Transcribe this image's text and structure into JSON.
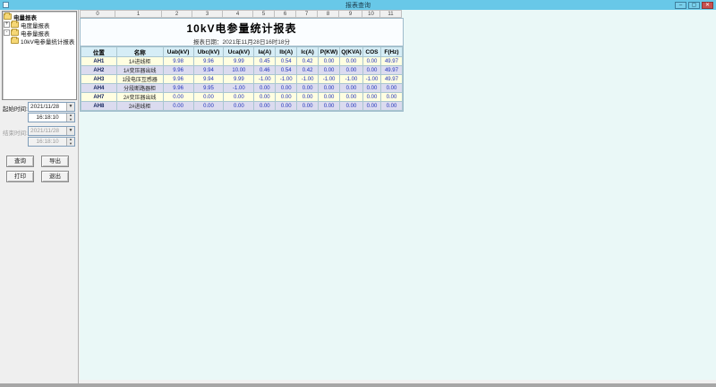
{
  "window": {
    "title": "报表查询",
    "minimize_glyph": "–",
    "maximize_glyph": "▢",
    "close_glyph": "✕"
  },
  "sidebar": {
    "tree": {
      "root_label": "电量报表",
      "items": [
        {
          "label": "电度量报表",
          "expander": "+",
          "level": 1
        },
        {
          "label": "电参量报表",
          "expander": "-",
          "level": 1
        },
        {
          "label": "10kV电参量统计报表",
          "expander": "",
          "level": 2
        }
      ]
    },
    "start_time_label": "起始时间:",
    "end_time_label": "结束时间:",
    "start_date": "2021/11/28",
    "start_time": "16:18:10",
    "end_date": "2021/11/28",
    "end_time": "16:18:10",
    "dropdown_glyph": "▼",
    "spin_up_glyph": "▲",
    "spin_down_glyph": "▼",
    "buttons": {
      "query": "查询",
      "export": "导出",
      "print": "打印",
      "exit": "退出"
    }
  },
  "report": {
    "ruler": [
      "0",
      "1",
      "2",
      "3",
      "4",
      "5",
      "6",
      "7",
      "8",
      "9",
      "10",
      "11"
    ],
    "title": "10kV电参量统计报表",
    "date_line": "报表日期：2021年11月28日16时18分",
    "columns": [
      "位置",
      "名称",
      "Uab(kV)",
      "Ubc(kV)",
      "Uca(kV)",
      "Ia(A)",
      "Ib(A)",
      "Ic(A)",
      "P(KW)",
      "Q(KVA)",
      "COS",
      "F(Hz)"
    ],
    "rows": [
      {
        "loc": "AH1",
        "name": "1#进线柜",
        "values": [
          "9.98",
          "9.96",
          "9.99",
          "0.45",
          "0.54",
          "0.42",
          "0.00",
          "0.00",
          "0.00",
          "49.97"
        ]
      },
      {
        "loc": "AH2",
        "name": "1#变压器出线",
        "values": [
          "9.96",
          "9.94",
          "10.00",
          "0.46",
          "0.54",
          "0.42",
          "0.00",
          "0.00",
          "0.00",
          "49.97"
        ]
      },
      {
        "loc": "AH3",
        "name": "1段电压互感器",
        "values": [
          "9.96",
          "9.94",
          "9.99",
          "-1.00",
          "-1.00",
          "-1.00",
          "-1.00",
          "-1.00",
          "-1.00",
          "49.97"
        ]
      },
      {
        "loc": "AH4",
        "name": "分段断路器柜",
        "values": [
          "9.96",
          "9.95",
          "-1.00",
          "0.00",
          "0.00",
          "0.00",
          "0.00",
          "0.00",
          "0.00",
          "0.00"
        ]
      },
      {
        "loc": "AH7",
        "name": "2#变压器出线",
        "values": [
          "0.00",
          "0.00",
          "0.00",
          "0.00",
          "0.00",
          "0.00",
          "0.00",
          "0.00",
          "0.00",
          "0.00"
        ]
      },
      {
        "loc": "AH8",
        "name": "2#进线柜",
        "values": [
          "0.00",
          "0.00",
          "0.00",
          "0.00",
          "0.00",
          "0.00",
          "0.00",
          "0.00",
          "0.00",
          "0.00"
        ]
      }
    ]
  },
  "colors": {
    "titlebar": "#68c8e8",
    "close_button": "#c75050",
    "main_background": "#eaf8f7",
    "header_cell": "#d6edf6",
    "row_cream": "#fffee1",
    "row_lavender": "#dbdbef",
    "value_blue": "#2233bb"
  }
}
